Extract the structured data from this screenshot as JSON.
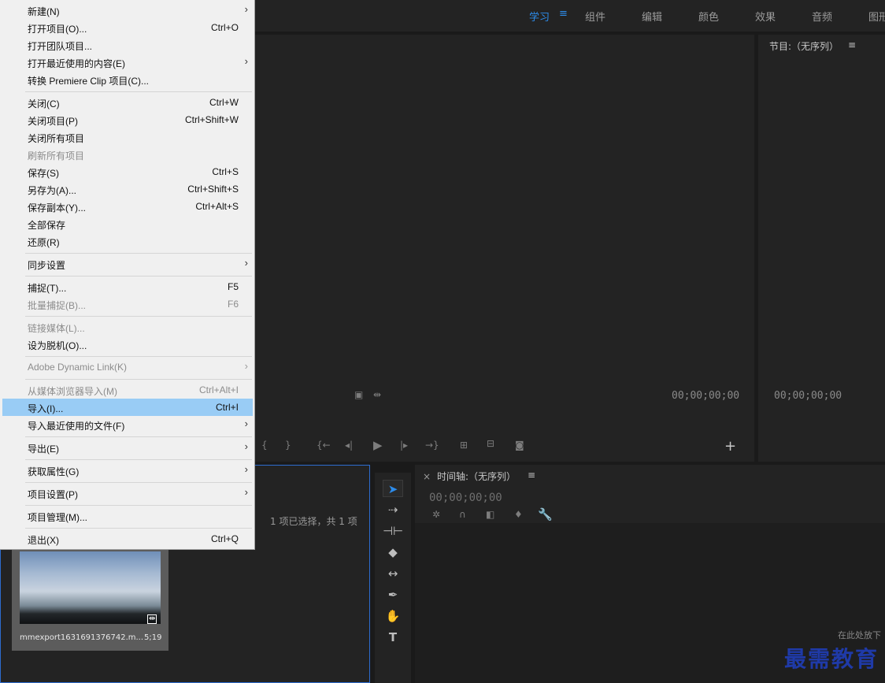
{
  "workspace_tabs": [
    {
      "label": "学习",
      "active": true
    },
    {
      "label": "组件",
      "active": false
    },
    {
      "label": "编辑",
      "active": false
    },
    {
      "label": "颜色",
      "active": false
    },
    {
      "label": "效果",
      "active": false
    },
    {
      "label": "音频",
      "active": false
    },
    {
      "label": "图形",
      "active": false
    }
  ],
  "workspace_menu_glyph": "≡",
  "source_monitor": {
    "timecode": "00;00;00;00",
    "add_glyph": "+"
  },
  "program_monitor": {
    "title": "节目:（无序列）",
    "menu_glyph": "≡",
    "timecode": "00;00;00;00"
  },
  "project_panel": {
    "selection_status": "1 项已选择，共 1 项",
    "clip": {
      "name": "mmexport1631691376742.m...",
      "duration": "5;19"
    }
  },
  "timeline": {
    "close_glyph": "×",
    "title": "时间轴:（无序列）",
    "menu_glyph": "≡",
    "timecode": "00;00;00;00",
    "drop_hint": "在此处放下"
  },
  "file_menu": {
    "highlight_color": "#99ccf5",
    "items": [
      {
        "label": "新建(N)",
        "shortcut": "",
        "submenu": true,
        "disabled": false
      },
      {
        "label": "打开项目(O)...",
        "shortcut": "Ctrl+O",
        "submenu": false,
        "disabled": false
      },
      {
        "label": "打开团队项目...",
        "shortcut": "",
        "submenu": false,
        "disabled": false
      },
      {
        "label": "打开最近使用的内容(E)",
        "shortcut": "",
        "submenu": true,
        "disabled": false
      },
      {
        "label": "转换 Premiere Clip 项目(C)...",
        "shortcut": "",
        "submenu": false,
        "disabled": false
      },
      {
        "label": "关闭(C)",
        "shortcut": "Ctrl+W",
        "submenu": false,
        "disabled": false
      },
      {
        "label": "关闭项目(P)",
        "shortcut": "Ctrl+Shift+W",
        "submenu": false,
        "disabled": false
      },
      {
        "label": "关闭所有项目",
        "shortcut": "",
        "submenu": false,
        "disabled": false
      },
      {
        "label": "刷新所有项目",
        "shortcut": "",
        "submenu": false,
        "disabled": true
      },
      {
        "label": "保存(S)",
        "shortcut": "Ctrl+S",
        "submenu": false,
        "disabled": false
      },
      {
        "label": "另存为(A)...",
        "shortcut": "Ctrl+Shift+S",
        "submenu": false,
        "disabled": false
      },
      {
        "label": "保存副本(Y)...",
        "shortcut": "Ctrl+Alt+S",
        "submenu": false,
        "disabled": false
      },
      {
        "label": "全部保存",
        "shortcut": "",
        "submenu": false,
        "disabled": false
      },
      {
        "label": "还原(R)",
        "shortcut": "",
        "submenu": false,
        "disabled": false
      },
      {
        "label": "同步设置",
        "shortcut": "",
        "submenu": true,
        "disabled": false
      },
      {
        "label": "捕捉(T)...",
        "shortcut": "F5",
        "submenu": false,
        "disabled": false
      },
      {
        "label": "批量捕捉(B)...",
        "shortcut": "F6",
        "submenu": false,
        "disabled": true
      },
      {
        "label": "链接媒体(L)...",
        "shortcut": "",
        "submenu": false,
        "disabled": true
      },
      {
        "label": "设为脱机(O)...",
        "shortcut": "",
        "submenu": false,
        "disabled": false
      },
      {
        "label": "Adobe Dynamic Link(K)",
        "shortcut": "",
        "submenu": true,
        "disabled": true
      },
      {
        "label": "从媒体浏览器导入(M)",
        "shortcut": "Ctrl+Alt+I",
        "submenu": false,
        "disabled": true
      },
      {
        "label": "导入(I)...",
        "shortcut": "Ctrl+I",
        "submenu": false,
        "disabled": false,
        "highlighted": true
      },
      {
        "label": "导入最近使用的文件(F)",
        "shortcut": "",
        "submenu": true,
        "disabled": false
      },
      {
        "label": "导出(E)",
        "shortcut": "",
        "submenu": true,
        "disabled": false
      },
      {
        "label": "获取属性(G)",
        "shortcut": "",
        "submenu": true,
        "disabled": false
      },
      {
        "label": "项目设置(P)",
        "shortcut": "",
        "submenu": true,
        "disabled": false
      },
      {
        "label": "项目管理(M)...",
        "shortcut": "",
        "submenu": false,
        "disabled": false
      },
      {
        "label": "退出(X)",
        "shortcut": "Ctrl+Q",
        "submenu": false,
        "disabled": false
      }
    ]
  },
  "tools": [
    "selection-tool-icon",
    "track-select-tool-icon",
    "ripple-edit-tool-icon",
    "razor-tool-icon",
    "slip-tool-icon",
    "pen-tool-icon",
    "hand-tool-icon",
    "type-tool-icon"
  ],
  "watermark": "最需教育"
}
